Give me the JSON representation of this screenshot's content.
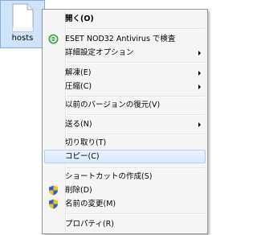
{
  "file": {
    "name": "hosts",
    "icon": "document-icon"
  },
  "menu": {
    "items": [
      {
        "label": "開く(O)"
      },
      {
        "label": "ESET NOD32 Antivirus で検査",
        "icon": "eset-icon"
      },
      {
        "label": "詳細設定オプション"
      },
      {
        "label": "解凍(E)"
      },
      {
        "label": "圧縮(C)"
      },
      {
        "label": "以前のバージョンの復元(V)"
      },
      {
        "label": "送る(N)"
      },
      {
        "label": "切り取り(T)"
      },
      {
        "label": "コピー(C)"
      },
      {
        "label": "ショートカットの作成(S)"
      },
      {
        "label": "削除(D)",
        "icon": "uac-shield-icon"
      },
      {
        "label": "名前の変更(M)",
        "icon": "uac-shield-icon"
      },
      {
        "label": "プロパティ(R)"
      }
    ]
  },
  "colors": {
    "selection_bg": "#cfe4fa",
    "selection_border": "#84acdd",
    "menu_bg": "#f5f5f5",
    "hover_border": "#aecff7"
  }
}
